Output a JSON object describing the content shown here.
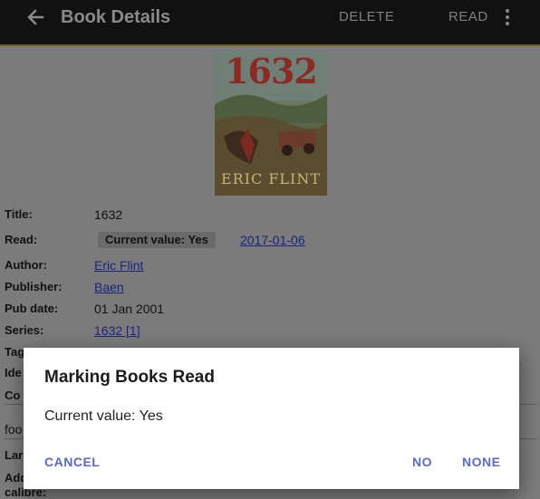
{
  "appbar": {
    "title": "Book Details",
    "delete_label": "DELETE",
    "read_label": "READ",
    "back_icon": "arrow-back-icon",
    "menu_icon": "more-vert-icon"
  },
  "cover": {
    "title": "1632",
    "author": "ERIC FLINT"
  },
  "details": {
    "title_label": "Title:",
    "title_value": "1632",
    "read_label": "Read:",
    "read_chip": "Current value: Yes",
    "read_date": "2017-01-06",
    "author_label": "Author:",
    "author_value": "Eric Flint",
    "publisher_label": "Publisher:",
    "publisher_value": "Baen",
    "pubdate_label": "Pub date:",
    "pubdate_value": "01 Jan 2001",
    "series_label": "Series:",
    "series_value": "1632 [1]",
    "tags_label": "Tag",
    "ids_label": "Ide",
    "comments_label": "Co",
    "comments_value": "foo",
    "languages_label": "Lar",
    "added_label_1": "Add",
    "added_label_2": "calibre:"
  },
  "dialog": {
    "title": "Marking Books Read",
    "message": "Current value: Yes",
    "cancel_label": "CANCEL",
    "no_label": "NO",
    "none_label": "NONE"
  },
  "colors": {
    "appbar_bg": "#111111",
    "accent_line": "#6e5e1c",
    "dialog_button": "#5c6bc0",
    "link": "#1a237e"
  }
}
